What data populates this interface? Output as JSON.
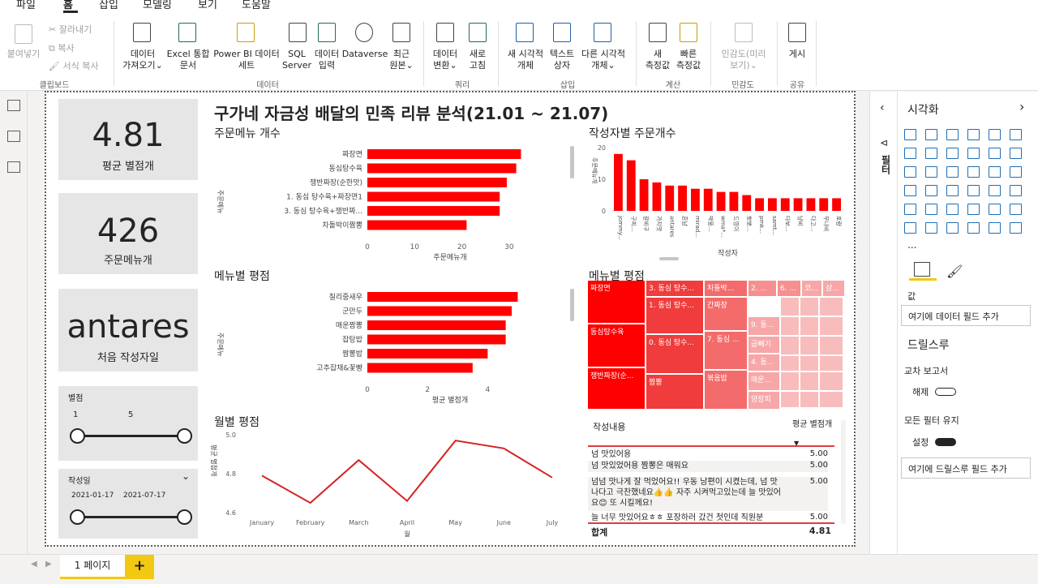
{
  "menu": [
    "파일",
    "홈",
    "삽입",
    "모델링",
    "보기",
    "도움말"
  ],
  "ribbon": {
    "clipboard": {
      "paste": "붙여넣기",
      "cut": "잘라내기",
      "copy": "복사",
      "format": "서식 복사",
      "group": "클립보드"
    },
    "data": {
      "get_data": [
        "데이터",
        "가져오기⌄"
      ],
      "excel": [
        "Excel 통합",
        "문서"
      ],
      "pbi": [
        "Power BI 데이터",
        "세트"
      ],
      "sql": [
        "SQL",
        "Server"
      ],
      "enter": [
        "데이터",
        "입력"
      ],
      "dataverse": "Dataverse",
      "recent": [
        "최근",
        "원본⌄"
      ],
      "group": "데이터"
    },
    "query": {
      "transform": [
        "데이터",
        "변환⌄"
      ],
      "refresh": [
        "새로",
        "고침"
      ],
      "group": "쿼리"
    },
    "insert": {
      "new_visual": [
        "새 시각적",
        "개체"
      ],
      "textbox": [
        "텍스트",
        "상자"
      ],
      "more": [
        "다른 시각적",
        "개체⌄"
      ],
      "group": "삽입"
    },
    "calc": {
      "new_measure": [
        "새",
        "측정값"
      ],
      "quick_measure": [
        "빠른",
        "측정값"
      ],
      "group": "계산"
    },
    "sensitivity": {
      "label": [
        "민감도(미리",
        "보기)⌄"
      ],
      "group": "민감도"
    },
    "share": {
      "publish": "게시",
      "group": "공유"
    }
  },
  "report": {
    "title": "구가네 자금성 배달의 민족 리뷰 분석(21.01 ~ 21.07)",
    "cards": [
      {
        "value": "4.81",
        "label": "평균 별점개"
      },
      {
        "value": "426",
        "label": "주문메뉴개"
      },
      {
        "value": "antares",
        "label": "처음 작성자일"
      }
    ],
    "slicer_star": {
      "title": "별점",
      "min": "1",
      "max": "5"
    },
    "slicer_date": {
      "title": "작성일",
      "min": "2021-01-17",
      "max": "2021-07-17",
      "chevron": "⌄"
    }
  },
  "chart_data": [
    {
      "type": "bar",
      "orientation": "horizontal",
      "title": "주문메뉴 개수",
      "categories": [
        "짜장면",
        "동심탕수육",
        "쟁반짜장(순한맛)",
        "1. 동심 탕수육+짜장면1",
        "3. 동심 탕수육+쟁반짜...",
        "차돌박이짬뽕"
      ],
      "values": [
        32.5,
        31.5,
        29.5,
        28,
        28,
        21
      ],
      "xlabel": "주문메뉴개",
      "ylabel": "주문메뉴",
      "xticks": [
        0,
        10,
        20,
        30
      ],
      "xlim": [
        0,
        35
      ],
      "color": "#ff0000"
    },
    {
      "type": "bar",
      "orientation": "vertical",
      "title": "작성자별 주문개수",
      "categories": [
        "jommy...",
        "구피...",
        "갈비구",
        "가지맛",
        "antares",
        "흔남",
        "mirad...",
        "박뚱...",
        "wma*...",
        "드영이",
        "뽀뽀...",
        "pmk...",
        "samt...",
        "다보...",
        "냥비",
        "다고...",
        "무나비",
        "호랑"
      ],
      "values": [
        18,
        16,
        10,
        9,
        8,
        8,
        7,
        7,
        6,
        6,
        5,
        4,
        4,
        4,
        4,
        4,
        4,
        4
      ],
      "xlabel": "작성자",
      "ylabel": "주문메뉴개",
      "yticks": [
        0,
        10,
        20
      ],
      "ylim": [
        0,
        20
      ],
      "color": "#ff0000"
    },
    {
      "type": "bar",
      "orientation": "horizontal",
      "title": "메뉴별 평점",
      "categories": [
        "칠리중새우",
        "군만두",
        "매운짬뽕",
        "잡탕밥",
        "짬뽕밥",
        "고추잡채&꽃빵"
      ],
      "values": [
        5,
        4.8,
        4.6,
        4.6,
        4.0,
        3.5
      ],
      "xlabel": "평균 별점개",
      "ylabel": "주문메뉴",
      "xticks": [
        0,
        2,
        4
      ],
      "xlim": [
        0,
        5.5
      ],
      "color": "#ff0000"
    },
    {
      "type": "line",
      "title": "월별 평점",
      "x": [
        "January",
        "February",
        "March",
        "April",
        "May",
        "June",
        "July"
      ],
      "values": [
        4.79,
        4.65,
        4.87,
        4.66,
        4.97,
        4.93,
        4.78
      ],
      "xlabel": "월",
      "ylabel": "평균 별점개",
      "yticks": [
        4.6,
        4.8,
        5.0
      ],
      "ylim": [
        4.6,
        5.0
      ],
      "color": "#d62222"
    },
    {
      "type": "treemap",
      "title": "메뉴별 평점",
      "cells": [
        "짜장면",
        "3. 동심 탕수...",
        "차돌박...",
        "2. ...",
        "6. ...",
        "코...",
        "삼...",
        "동심탕수육",
        "1. 동심 탕수...",
        "간짜장",
        "9. 동...",
        "쟁반짜장(순...",
        "0. 동심 탕수...",
        "7. 동심 ...",
        "곱빼기",
        "4. 동...",
        "짬뽕",
        "볶음밥",
        "매운...",
        "양장피"
      ]
    }
  ],
  "table": {
    "headers": [
      "작성내용",
      "평균 별점개"
    ],
    "sort": "▼",
    "rows": [
      {
        "text": "넘 맛있어용",
        "score": "5.00"
      },
      {
        "text": "넘 맛있었어용 짬뽕은 매워요",
        "score": "5.00"
      },
      {
        "text": "넘넘 맛나게 잘 먹었어요!! 우동 남편이 시켰는데, 넘 맛나다고 극찬했네요👍👍 자주 시켜먹고있는데 늘 맛있어요😊 또 시킬께요!",
        "score": "5.00"
      },
      {
        "text": "늘 너무 맛있어요ㅎㅎ 포장하러 갔건 첫인데 직원분",
        "score": "5.00"
      }
    ],
    "total_label": "합계",
    "total_value": "4.81"
  },
  "panel": {
    "title": "시각화",
    "filter_label": "필터",
    "values_label": "값",
    "add_field": "여기에 데이터 필드 추가",
    "drill_title": "드릴스루",
    "cross_report": "교차 보고서",
    "cross_state": "해제",
    "keep_filters": "모든 필터 유지",
    "keep_state": "설정",
    "add_drill": "여기에 드릴스루 필드 추가",
    "more": "...",
    "accent": "#f2c811"
  },
  "pages": {
    "tab": "1 페이지",
    "add": "+"
  }
}
